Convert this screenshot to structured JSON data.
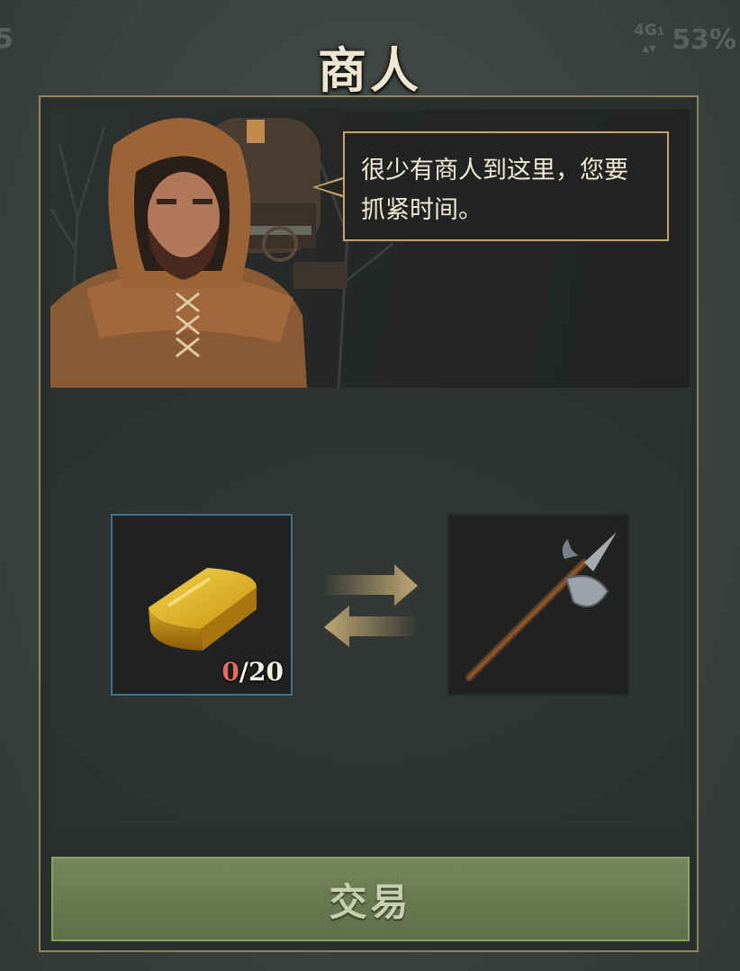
{
  "status_bar": {
    "left_fragment": "5",
    "signal_label": "4G",
    "signal_sub": "1",
    "battery": "53%"
  },
  "title": "商人",
  "merchant": {
    "dialogue_line1": "很少有商人到这里，您要",
    "dialogue_line2": "抓紧时间。"
  },
  "trade": {
    "give_item": {
      "icon": "gold-bar-icon",
      "have": "0",
      "separator": "/",
      "need": "20"
    },
    "receive_item": {
      "icon": "halberd-icon"
    }
  },
  "trade_button_label": "交易",
  "colors": {
    "title_text": "#f0e6cf",
    "frame_gold": "#8e8465",
    "speech_border": "#c4a36a",
    "slot_highlight": "#3f7489",
    "count_deficit": "#e06b63",
    "button_green": "#687b50",
    "button_text": "#c7cfae"
  }
}
